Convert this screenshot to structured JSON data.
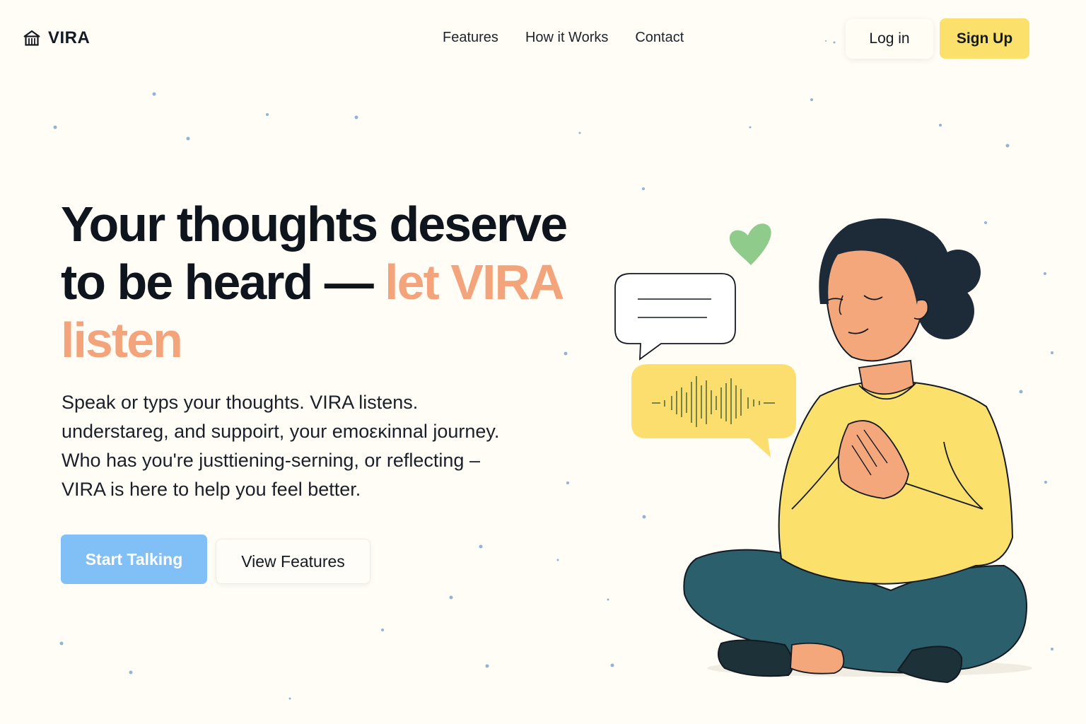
{
  "brand": {
    "name": "VIRA",
    "icon": "home-icon"
  },
  "nav": {
    "links": [
      "Features",
      "How it Works",
      "Contact"
    ]
  },
  "auth": {
    "login_label": "Log in",
    "signup_label": "Sign Up"
  },
  "hero": {
    "headline_part1": "Your thoughts deserve to be heard — ",
    "headline_accent": "let VIRA listen",
    "subtext_lines": [
      "Speak or typs your thoughts. VIRA listens.",
      "understareg, and suppoirt, your emoεκinnal journey.",
      "Who has you're justtiening-serning, or reflecting –",
      "VIRA is here to help you feel better."
    ],
    "start_button": "Start Talking",
    "features_button": "View Features"
  },
  "colors": {
    "background": "#fffdf6",
    "accent_orange": "#f4a47a",
    "primary_blue": "#80c0f7",
    "signup_yellow": "#fbe06c",
    "heart_green": "#8fcb8a",
    "sweater_yellow": "#fbe06c",
    "pants_teal": "#2b5f6c"
  },
  "illustration": {
    "icons": [
      "heart-icon",
      "chat-bubble-icon",
      "voice-wave-icon",
      "meditating-person-illustration"
    ]
  }
}
